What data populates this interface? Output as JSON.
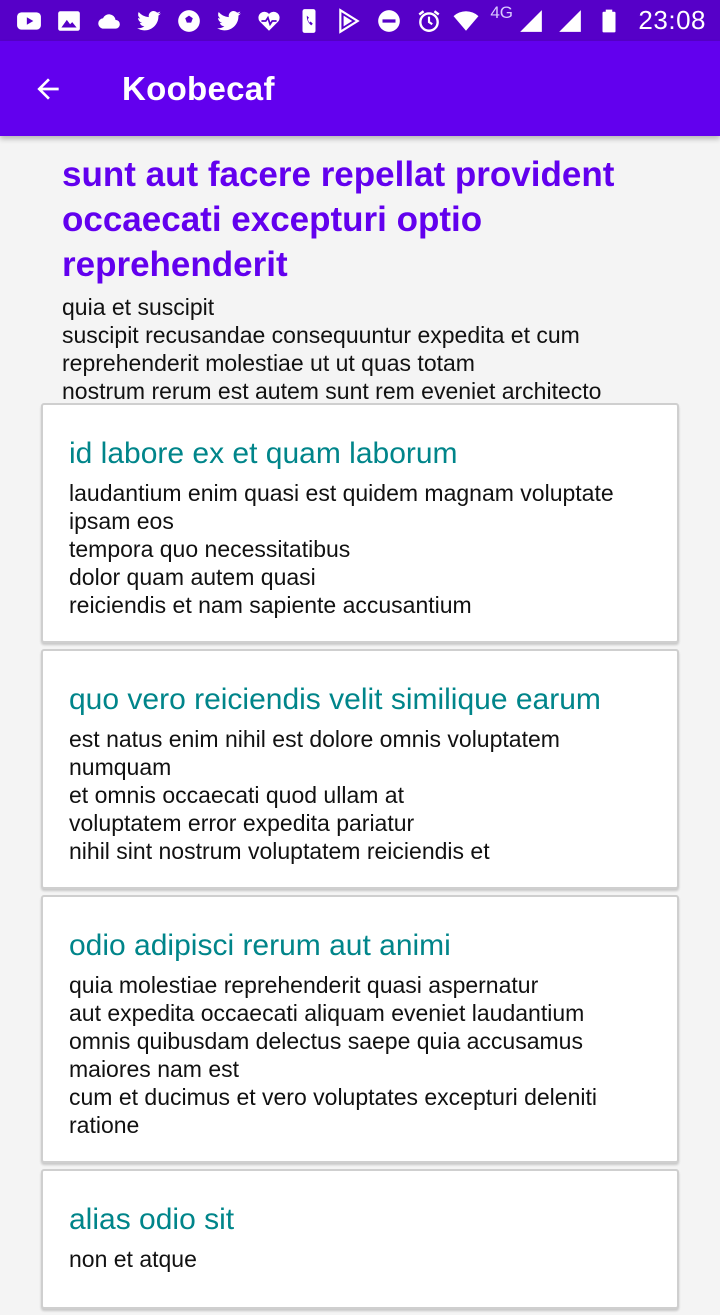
{
  "status_bar": {
    "left_icons": [
      "youtube-icon",
      "gallery-icon",
      "cloud-icon",
      "twitter-icon",
      "soccer-ball-icon",
      "twitter-icon",
      "heart-pulse-icon",
      "phone-icon",
      "play-store-icon",
      "do-not-disturb-icon",
      "alarm-icon"
    ],
    "network_label": "4G",
    "time": "23:08"
  },
  "app_bar": {
    "title": "Koobecaf",
    "background": "#6200ee"
  },
  "post": {
    "title": "sunt aut facere repellat provident occaecati excepturi optio reprehenderit",
    "body": "quia et suscipit\nsuscipit recusandae consequuntur expedita et cum\nreprehenderit molestiae ut ut quas totam\nnostrum rerum est autem sunt rem eveniet architecto"
  },
  "comments": [
    {
      "title": "id labore ex et quam laborum",
      "body": "laudantium enim quasi est quidem magnam voluptate ipsam eos\ntempora quo necessitatibus\ndolor quam autem quasi\nreiciendis et nam sapiente accusantium"
    },
    {
      "title": "quo vero reiciendis velit similique earum",
      "body": "est natus enim nihil est dolore omnis voluptatem numquam\net omnis occaecati quod ullam at\nvoluptatem error expedita pariatur\nnihil sint nostrum voluptatem reiciendis et"
    },
    {
      "title": "odio adipisci rerum aut animi",
      "body": "quia molestiae reprehenderit quasi aspernatur\naut expedita occaecati aliquam eveniet laudantium\nomnis quibusdam delectus saepe quia accusamus maiores nam est\ncum et ducimus et vero voluptates excepturi deleniti ratione"
    },
    {
      "title": "alias odio sit",
      "body": "non et atque"
    }
  ]
}
